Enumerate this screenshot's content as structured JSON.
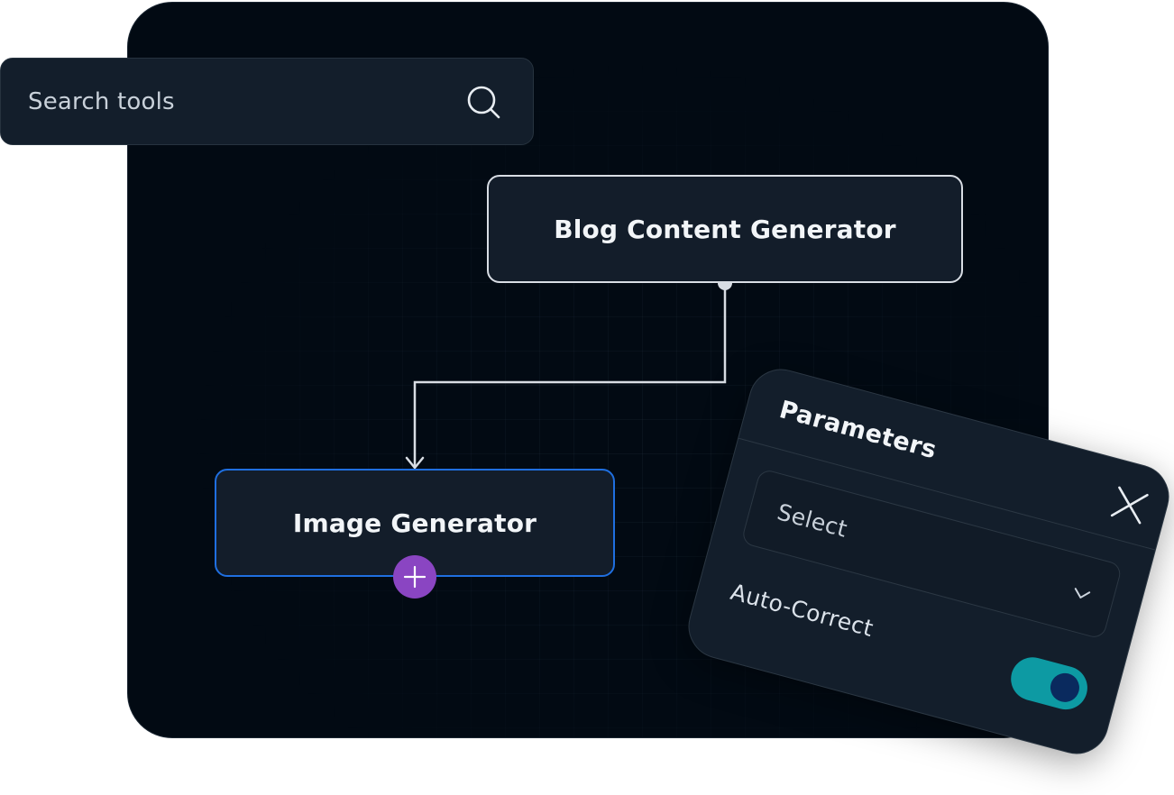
{
  "search": {
    "placeholder": "Search tools",
    "icon": "search-icon"
  },
  "flow": {
    "nodes": [
      {
        "id": "blog",
        "label": "Blog Content Generator",
        "border_color": "#d8dde4"
      },
      {
        "id": "image",
        "label": "Image Generator",
        "border_color": "#1f6fe0"
      }
    ],
    "add_button": {
      "icon": "plus-icon",
      "color": "#8a45c2"
    }
  },
  "parameters": {
    "title": "Parameters",
    "close_icon": "close-icon",
    "select": {
      "value": "Select",
      "icon": "chevron-down-icon"
    },
    "auto_correct": {
      "label": "Auto-Correct",
      "enabled": true,
      "on_color": "#0d9aa3"
    }
  },
  "colors": {
    "canvas_bg": "#020a13",
    "panel_bg": "#131e2b",
    "node_selected": "#1f6fe0",
    "accent_purple": "#8a45c2",
    "toggle_on": "#0d9aa3"
  }
}
